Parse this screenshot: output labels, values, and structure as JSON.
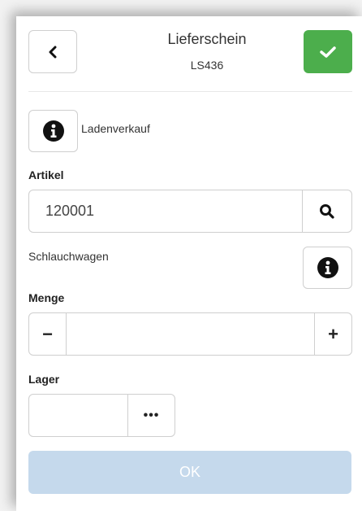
{
  "header": {
    "title": "Lieferschein",
    "subtitle": "LS436"
  },
  "customer": {
    "name": "Ladenverkauf"
  },
  "article": {
    "label": "Artikel",
    "value": "120001",
    "description": "Schlauchwagen"
  },
  "quantity": {
    "label": "Menge",
    "value": "",
    "minus": "−",
    "plus": "+"
  },
  "storage": {
    "label": "Lager",
    "value": "",
    "more": "•••"
  },
  "actions": {
    "ok_label": "OK"
  },
  "icons": {
    "back": "chevron-left-icon",
    "confirm": "check-icon",
    "info": "info-circle-icon",
    "search": "search-icon"
  },
  "colors": {
    "confirm_green": "#4cae4c",
    "ok_disabled": "#c5d9ec"
  }
}
